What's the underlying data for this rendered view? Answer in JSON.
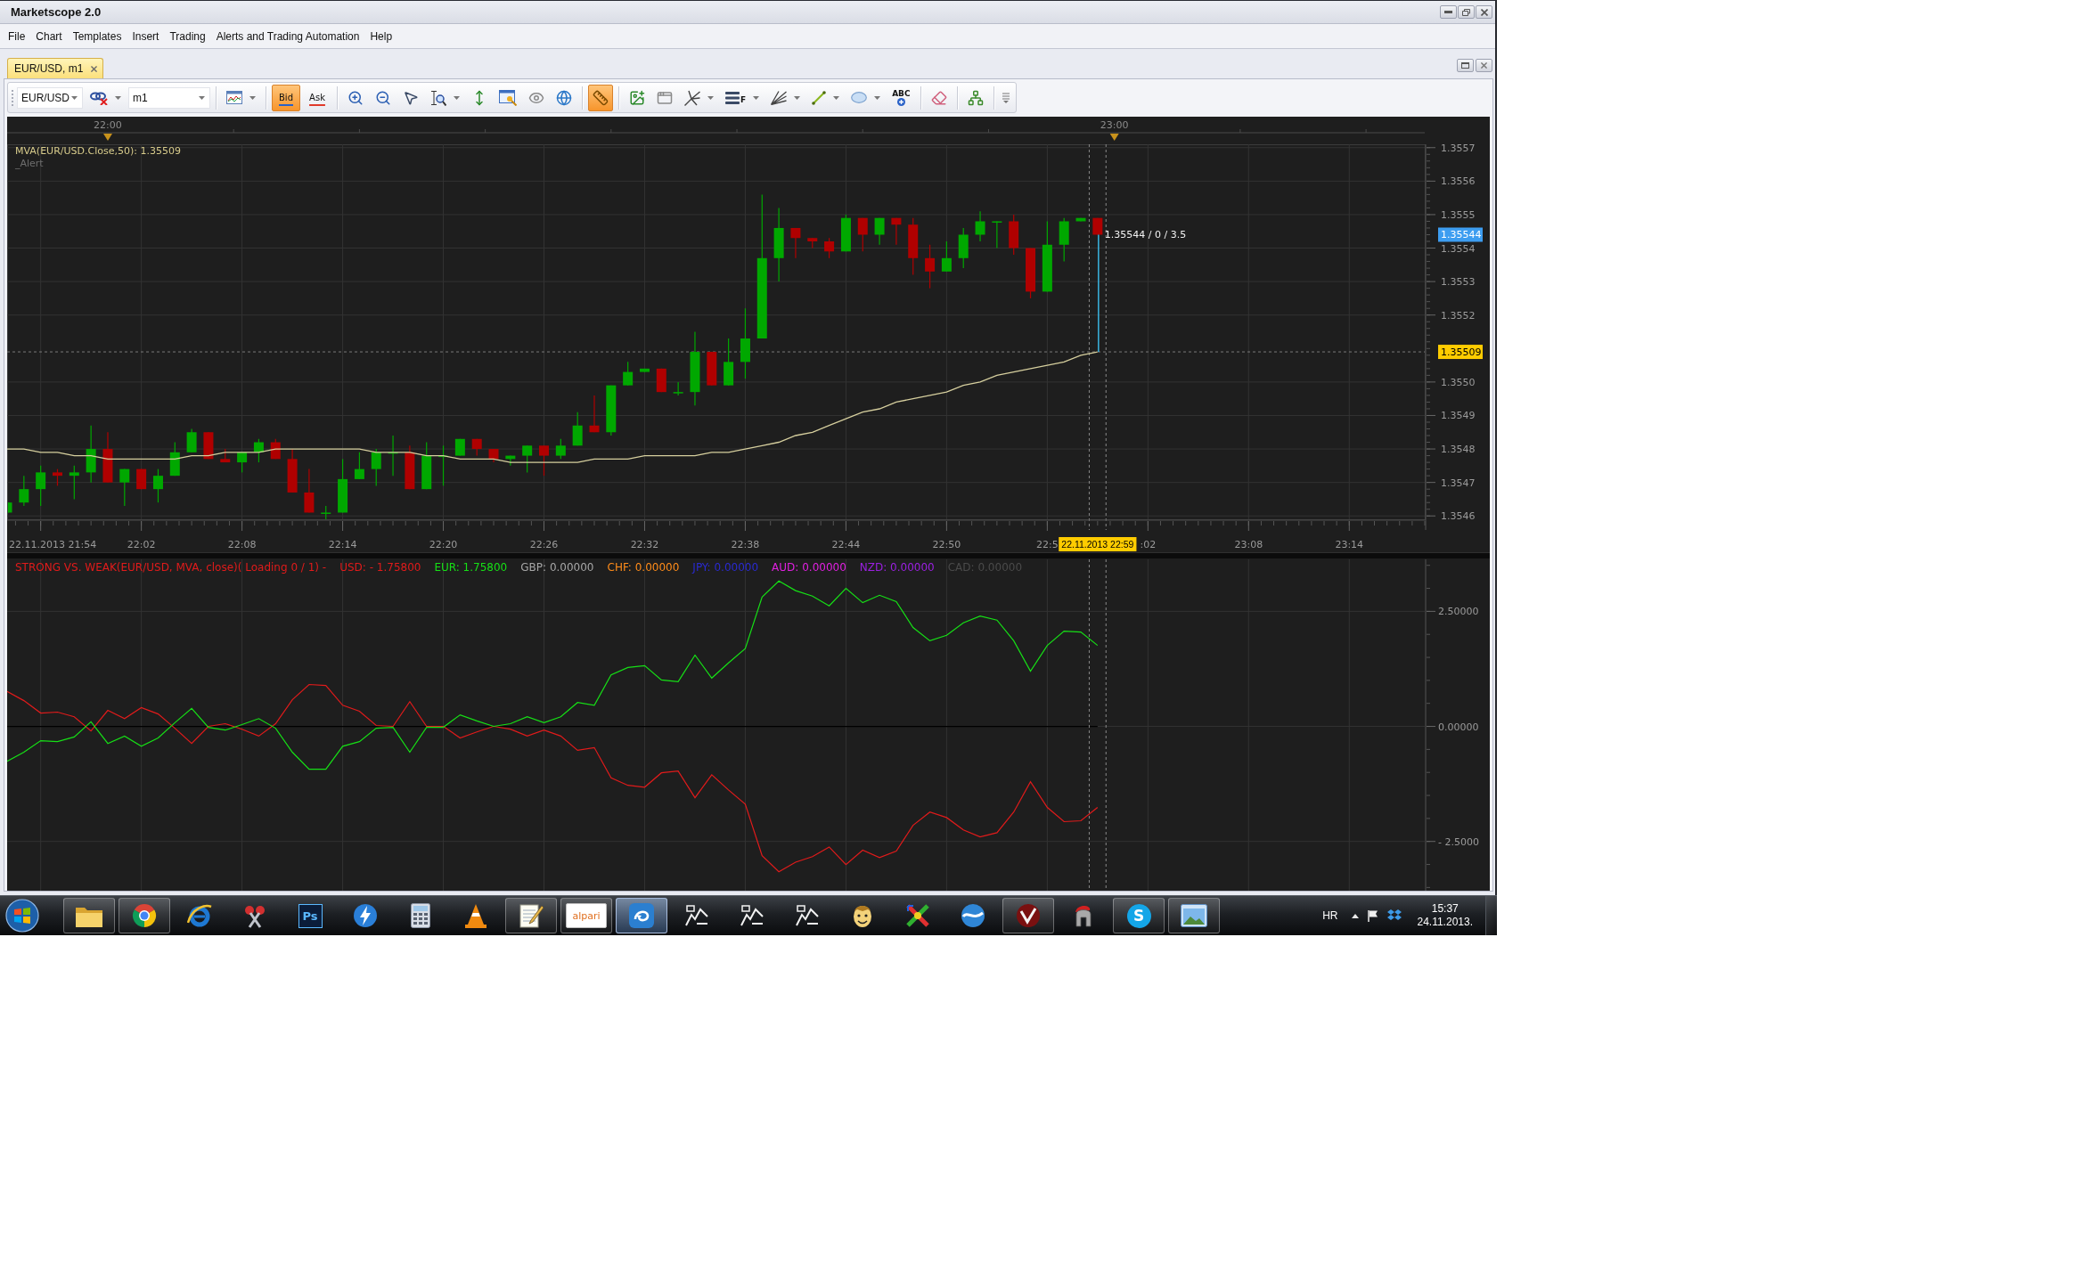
{
  "window": {
    "title": "Marketscope 2.0"
  },
  "menu": [
    "File",
    "Chart",
    "Templates",
    "Insert",
    "Trading",
    "Alerts and Trading Automation",
    "Help"
  ],
  "tabs": [
    {
      "label": "EUR/USD, m1",
      "selected": true
    }
  ],
  "toolbar": {
    "instrument": "EUR/USD",
    "timeframe": "m1",
    "price_modes": [
      {
        "label": "Bid",
        "selected": true
      },
      {
        "label": "Ask",
        "selected": false
      }
    ],
    "tools": [
      {
        "selected": false
      },
      {
        "selected": false
      },
      {
        "selected": false
      },
      {
        "selected": false
      },
      {
        "selected": false
      },
      {
        "selected": false
      },
      {
        "selected": false
      },
      {
        "selected": false
      },
      {
        "selected": false
      },
      {
        "selected": false
      },
      {
        "selected": true
      },
      {
        "selected": false
      },
      {
        "selected": false
      },
      {
        "selected": false
      },
      {
        "label": "F",
        "selected": false
      },
      {
        "selected": false
      },
      {
        "selected": false
      },
      {
        "selected": false
      },
      {
        "label": "ABC",
        "selected": false
      },
      {
        "selected": false
      },
      {
        "selected": false
      }
    ]
  },
  "price_chart": {
    "indicator_label": "MVA(EUR/USD.Close,50): 1.35509",
    "alert_label": "_Alert",
    "start_label": "22.11.2013 21:54",
    "hour_labels": [
      "22:00",
      "23:00"
    ],
    "chart_data": {
      "type": "candlestick",
      "grid": true,
      "categories": [
        null,
        null,
        null,
        null,
        null,
        null,
        null,
        null,
        "22:02",
        null,
        null,
        null,
        null,
        null,
        "22:08",
        null,
        null,
        null,
        null,
        null,
        "22:14",
        null,
        null,
        null,
        null,
        null,
        "22:20",
        null,
        null,
        null,
        null,
        null,
        "22:26",
        null,
        null,
        null,
        null,
        null,
        "22:32",
        null,
        null,
        null,
        null,
        null,
        "22:38",
        null,
        null,
        null,
        null,
        null,
        "22:44",
        null,
        null,
        null,
        null,
        null,
        "22:50",
        null,
        null,
        null,
        null,
        null,
        "22:5",
        null,
        null,
        null,
        null,
        null,
        ":02",
        null,
        null,
        null,
        null,
        null,
        "23:08",
        null,
        null,
        null,
        null,
        null,
        "23:14",
        null,
        null,
        null,
        null
      ],
      "ylim": [
        1.35459,
        1.35571
      ],
      "yticks": [
        {
          "value": 1.3557,
          "label": "1.3557"
        },
        {
          "value": 1.3556,
          "label": "1.3556"
        },
        {
          "value": 1.3555,
          "label": "1.3555"
        },
        {
          "value": 1.3554,
          "label": "1.3554"
        },
        {
          "value": 1.3553,
          "label": "1.3553"
        },
        {
          "value": 1.3552,
          "label": "1.3552"
        },
        {
          "value": 1.355,
          "label": "1.3550"
        },
        {
          "value": 1.3549,
          "label": "1.3549"
        },
        {
          "value": 1.3548,
          "label": "1.3548"
        },
        {
          "value": 1.3547,
          "label": "1.3547"
        },
        {
          "value": 1.3546,
          "label": "1.3546"
        }
      ],
      "series": [
        {
          "ohlc": [
            [
              1.35461,
              1.35464,
              1.35461,
              1.35464
            ],
            [
              1.35464,
              1.35472,
              1.35463,
              1.35468
            ],
            [
              1.35468,
              1.35475,
              1.35463,
              1.35473
            ],
            [
              1.35473,
              1.35474,
              1.35469,
              1.35472
            ],
            [
              1.35472,
              1.35475,
              1.35465,
              1.35473
            ],
            [
              1.35473,
              1.35487,
              1.3547,
              1.3548
            ],
            [
              1.3548,
              1.35485,
              1.3547,
              1.3547
            ],
            [
              1.3547,
              1.35474,
              1.35463,
              1.35474
            ],
            [
              1.35474,
              1.35474,
              1.35468,
              1.35468
            ],
            [
              1.35468,
              1.35474,
              1.35464,
              1.35472
            ],
            [
              1.35472,
              1.35482,
              1.35472,
              1.35479
            ],
            [
              1.35479,
              1.35486,
              1.35479,
              1.35485
            ],
            [
              1.35485,
              1.35485,
              1.35477,
              1.35477
            ],
            [
              1.35477,
              1.3548,
              1.35476,
              1.35476
            ],
            [
              1.35476,
              1.35479,
              1.35473,
              1.35479
            ],
            [
              1.35479,
              1.35483,
              1.35476,
              1.35482
            ],
            [
              1.35482,
              1.35483,
              1.35477,
              1.35477
            ],
            [
              1.35477,
              1.3548,
              1.35467,
              1.35467
            ],
            [
              1.35467,
              1.35474,
              1.35461,
              1.35461
            ],
            [
              1.35461,
              1.35463,
              1.35459,
              1.35461
            ],
            [
              1.35461,
              1.35477,
              1.35461,
              1.35471
            ],
            [
              1.35471,
              1.35479,
              1.35471,
              1.35474
            ],
            [
              1.35474,
              1.3548,
              1.35469,
              1.35479
            ],
            [
              1.35479,
              1.35484,
              1.35472,
              1.35479
            ],
            [
              1.35479,
              1.35481,
              1.35468,
              1.35468
            ],
            [
              1.35468,
              1.35482,
              1.35468,
              1.35478
            ],
            [
              1.35478,
              1.35481,
              1.35469,
              1.35478
            ],
            [
              1.35478,
              1.35483,
              1.35478,
              1.35483
            ],
            [
              1.35483,
              1.35483,
              1.35478,
              1.3548
            ],
            [
              1.3548,
              1.3548,
              1.35476,
              1.35477
            ],
            [
              1.35477,
              1.35478,
              1.35475,
              1.35478
            ],
            [
              1.35478,
              1.35481,
              1.35473,
              1.35481
            ],
            [
              1.35481,
              1.35481,
              1.35472,
              1.35478
            ],
            [
              1.35478,
              1.35483,
              1.35477,
              1.35481
            ],
            [
              1.35481,
              1.35491,
              1.35481,
              1.35487
            ],
            [
              1.35487,
              1.35496,
              1.35485,
              1.35485
            ],
            [
              1.35485,
              1.35499,
              1.35484,
              1.35499
            ],
            [
              1.35499,
              1.35506,
              1.35499,
              1.35503
            ],
            [
              1.35503,
              1.35504,
              1.35503,
              1.35504
            ],
            [
              1.35504,
              1.35504,
              1.35497,
              1.35497
            ],
            [
              1.35497,
              1.355,
              1.35496,
              1.35497
            ],
            [
              1.35497,
              1.35515,
              1.35493,
              1.35509
            ],
            [
              1.35509,
              1.35509,
              1.35499,
              1.35499
            ],
            [
              1.35499,
              1.35513,
              1.35499,
              1.35506
            ],
            [
              1.35506,
              1.35522,
              1.35501,
              1.35513
            ],
            [
              1.35513,
              1.35556,
              1.35513,
              1.35537
            ],
            [
              1.35537,
              1.35552,
              1.3553,
              1.35546
            ],
            [
              1.35546,
              1.35546,
              1.35537,
              1.35543
            ],
            [
              1.35543,
              1.35543,
              1.3554,
              1.35542
            ],
            [
              1.35542,
              1.35543,
              1.35537,
              1.35539
            ],
            [
              1.35539,
              1.3555,
              1.35539,
              1.35549
            ],
            [
              1.35549,
              1.35549,
              1.35539,
              1.35544
            ],
            [
              1.35544,
              1.35549,
              1.35541,
              1.35549
            ],
            [
              1.35549,
              1.35549,
              1.35541,
              1.35547
            ],
            [
              1.35547,
              1.35549,
              1.35532,
              1.35537
            ],
            [
              1.35537,
              1.35541,
              1.35528,
              1.35533
            ],
            [
              1.35533,
              1.35542,
              1.35533,
              1.35537
            ],
            [
              1.35537,
              1.35546,
              1.35534,
              1.35544
            ],
            [
              1.35544,
              1.35551,
              1.35542,
              1.35548
            ],
            [
              1.35548,
              1.35548,
              1.3554,
              1.35548
            ],
            [
              1.35548,
              1.3555,
              1.35538,
              1.3554
            ],
            [
              1.3554,
              1.3554,
              1.35525,
              1.35527
            ],
            [
              1.35527,
              1.35548,
              1.35527,
              1.35541
            ],
            [
              1.35541,
              1.35549,
              1.35536,
              1.35548
            ],
            [
              1.35548,
              1.35549,
              1.35548,
              1.35549
            ],
            [
              1.35549,
              1.35549,
              1.35544,
              1.35544
            ],
            null,
            null,
            null,
            null,
            null,
            null,
            null,
            null,
            null,
            null,
            null,
            null,
            null,
            null,
            null,
            null,
            null,
            null,
            null
          ]
        },
        {
          "type": "line",
          "color": "#d6cf9e",
          "values": [
            1.3548,
            1.3548,
            1.35479,
            1.35479,
            1.35478,
            1.35478,
            1.35477,
            1.35477,
            1.35477,
            1.35477,
            1.35477,
            1.35478,
            1.35478,
            1.35479,
            1.35479,
            1.35479,
            1.3548,
            1.3548,
            1.3548,
            1.3548,
            1.3548,
            1.3548,
            1.35479,
            1.35479,
            1.35479,
            1.35478,
            1.35478,
            1.35477,
            1.35477,
            1.35477,
            1.35476,
            1.35476,
            1.35476,
            1.35476,
            1.35476,
            1.35477,
            1.35477,
            1.35477,
            1.35478,
            1.35478,
            1.35478,
            1.35478,
            1.35479,
            1.35479,
            1.3548,
            1.35481,
            1.35482,
            1.35484,
            1.35485,
            1.35487,
            1.35489,
            1.35491,
            1.35492,
            1.35494,
            1.35495,
            1.35496,
            1.35497,
            1.35499,
            1.355,
            1.35502,
            1.35503,
            1.35504,
            1.35505,
            1.35506,
            1.35508,
            1.35509,
            null,
            null,
            null,
            null,
            null,
            null,
            null,
            null,
            null,
            null,
            null,
            null,
            null,
            null,
            null,
            null,
            null,
            null,
            null
          ]
        }
      ],
      "ref_lines": [
        {
          "axis": "y",
          "value": 1.35509
        }
      ],
      "annotations": [
        "1.35544",
        "1.35509",
        "22.11.2013 22:59",
        "1.35544 / 0 / 3.5"
      ]
    }
  },
  "strength_panel": {
    "title": "STRONG VS. WEAK(EUR/USD, MVA, close)( Loading 0 / 1) -",
    "legend": [
      {
        "label": "USD: - 1.75800",
        "color": "#e11b1b"
      },
      {
        "label": "EUR: 1.75800",
        "color": "#16e016"
      },
      {
        "label": "GBP: 0.00000",
        "color": "#a6a6a6"
      },
      {
        "label": "CHF: 0.00000",
        "color": "#ff8c1a"
      },
      {
        "label": "JPY: 0.00000",
        "color": "#2a2ad0"
      },
      {
        "label": "AUD: 0.00000",
        "color": "#e020e0"
      },
      {
        "label": "NZD: 0.00000",
        "color": "#9a20e0"
      },
      {
        "label": "CAD: 0.00000",
        "color": "#4a4a4a"
      }
    ],
    "chart_data": {
      "type": "line",
      "grid": true,
      "ylim": [
        -3.57,
        3.63
      ],
      "yticks": [
        {
          "value": 2.5,
          "label": "2.50000"
        },
        {
          "value": 0,
          "label": "0.00000"
        },
        {
          "value": -2.5,
          "label": "- 2.5000"
        }
      ],
      "series": [
        {
          "color": "#e11b1b",
          "values": [
            0.76,
            0.56,
            0.29,
            0.31,
            0.21,
            -0.1,
            0.35,
            0.17,
            0.41,
            0.27,
            -0.04,
            -0.37,
            0,
            0.06,
            -0.06,
            -0.21,
            0.06,
            0.58,
            0.91,
            0.89,
            0.46,
            0.33,
            0.02,
            0,
            0.54,
            0,
            0,
            -0.25,
            -0.12,
            0,
            -0.06,
            -0.21,
            -0.08,
            -0.21,
            -0.52,
            -0.46,
            -1.12,
            -1.28,
            -1.32,
            -1.01,
            -0.97,
            -1.55,
            -1.05,
            -1.38,
            -1.69,
            -2.81,
            -3.16,
            -2.95,
            -2.83,
            -2.62,
            -3,
            -2.69,
            -2.85,
            -2.71,
            -2.15,
            -1.86,
            -1.98,
            -2.25,
            -2.4,
            -2.31,
            -1.86,
            -1.2,
            -1.76,
            -2.07,
            -2.05,
            -1.76
          ]
        },
        {
          "color": "#16e016",
          "values": [
            -0.76,
            -0.56,
            -0.31,
            -0.33,
            -0.23,
            0.1,
            -0.37,
            -0.21,
            -0.43,
            -0.25,
            0.08,
            0.39,
            -0.02,
            -0.08,
            0.04,
            0.17,
            -0.04,
            -0.56,
            -0.93,
            -0.93,
            -0.43,
            -0.33,
            -0.04,
            -0.02,
            -0.56,
            -0.02,
            -0.02,
            0.25,
            0.12,
            0,
            0.06,
            0.21,
            0.08,
            0.21,
            0.52,
            0.46,
            1.12,
            1.28,
            1.32,
            1.01,
            0.97,
            1.55,
            1.05,
            1.38,
            1.69,
            2.81,
            3.16,
            2.95,
            2.83,
            2.62,
            3,
            2.69,
            2.85,
            2.71,
            2.15,
            1.86,
            1.98,
            2.25,
            2.4,
            2.31,
            1.86,
            1.2,
            1.76,
            2.07,
            2.05,
            1.76
          ]
        }
      ]
    }
  },
  "taskbar": {
    "apps": [
      {
        "running": true,
        "selected": false
      },
      {
        "running": true,
        "selected": false
      },
      {
        "running": false,
        "selected": false
      },
      {
        "running": false,
        "selected": false
      },
      {
        "label": "Ps",
        "running": false,
        "selected": false
      },
      {
        "running": false,
        "selected": false
      },
      {
        "running": false,
        "selected": false
      },
      {
        "running": false,
        "selected": false
      },
      {
        "running": true,
        "selected": false
      },
      {
        "label": "alpari",
        "running": true,
        "selected": false
      },
      {
        "running": true,
        "selected": true
      },
      {
        "running": false,
        "selected": false
      },
      {
        "running": false,
        "selected": false
      },
      {
        "running": false,
        "selected": false
      },
      {
        "running": false,
        "selected": false
      },
      {
        "running": false,
        "selected": false
      },
      {
        "running": false,
        "selected": false
      },
      {
        "running": true,
        "selected": false
      },
      {
        "running": false,
        "selected": false
      },
      {
        "label": "S",
        "running": true,
        "selected": false
      },
      {
        "running": true,
        "selected": false
      }
    ],
    "language": "HR",
    "time": "15:37",
    "date": "24.11.2013."
  }
}
